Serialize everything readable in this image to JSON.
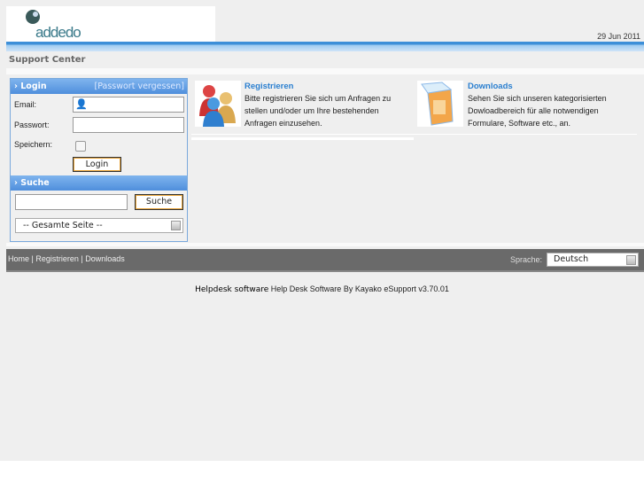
{
  "header": {
    "logo_text": "addedo",
    "date": "29 Jun 2011",
    "section_title": "Support Center"
  },
  "login": {
    "title": "Login",
    "forgot_link": "[Passwort vergessen]",
    "email_label": "Email:",
    "password_label": "Passwort:",
    "remember_label": "Speichern:",
    "login_button": "Login"
  },
  "search": {
    "title": "Suche",
    "button": "Suche",
    "scope_selected": "-- Gesamte Seite --"
  },
  "cards": [
    {
      "title": "Registrieren",
      "text": "Bitte registrieren Sie sich um Anfragen zu stellen und/oder um Ihre bestehenden Anfragen einzusehen.",
      "icon": "users-icon"
    },
    {
      "title": "Downloads",
      "text": "Sehen Sie sich unseren kategorisierten Dowloadbereich für alle notwendigen Formulare, Software etc., an.",
      "icon": "box-icon"
    }
  ],
  "footer": {
    "nav": [
      "Home",
      "Registrieren",
      "Downloads"
    ],
    "separator": " | ",
    "language_label": "Sprache:",
    "language_selected": "Deutsch"
  },
  "copyright": {
    "bold": "Helpdesk software",
    "text": " Help Desk Software By Kayako eSupport v3.70.01"
  }
}
